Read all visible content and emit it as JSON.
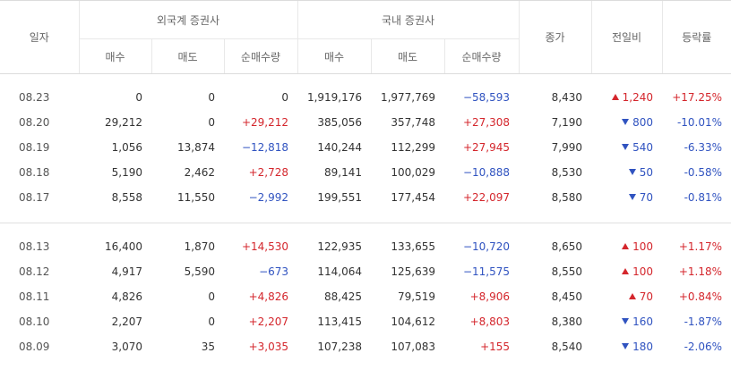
{
  "headers": {
    "date": "일자",
    "foreign_group": "외국계 증권사",
    "domestic_group": "국내 증권사",
    "buy": "매수",
    "sell": "매도",
    "net": "순매수량",
    "close": "종가",
    "change": "전일비",
    "rate": "등락률"
  },
  "group1": [
    {
      "date": "08.23",
      "f_buy": "0",
      "f_sell": "0",
      "f_net": "0",
      "d_buy": "1,919,176",
      "d_sell": "1,977,769",
      "d_net": "−58,593",
      "close": "8,430",
      "change": "1,240",
      "dir": "up",
      "rate": "+17.25%"
    },
    {
      "date": "08.20",
      "f_buy": "29,212",
      "f_sell": "0",
      "f_net": "+29,212",
      "d_buy": "385,056",
      "d_sell": "357,748",
      "d_net": "+27,308",
      "close": "7,190",
      "change": "800",
      "dir": "down",
      "rate": "-10.01%"
    },
    {
      "date": "08.19",
      "f_buy": "1,056",
      "f_sell": "13,874",
      "f_net": "−12,818",
      "d_buy": "140,244",
      "d_sell": "112,299",
      "d_net": "+27,945",
      "close": "7,990",
      "change": "540",
      "dir": "down",
      "rate": "-6.33%"
    },
    {
      "date": "08.18",
      "f_buy": "5,190",
      "f_sell": "2,462",
      "f_net": "+2,728",
      "d_buy": "89,141",
      "d_sell": "100,029",
      "d_net": "−10,888",
      "close": "8,530",
      "change": "50",
      "dir": "down",
      "rate": "-0.58%"
    },
    {
      "date": "08.17",
      "f_buy": "8,558",
      "f_sell": "11,550",
      "f_net": "−2,992",
      "d_buy": "199,551",
      "d_sell": "177,454",
      "d_net": "+22,097",
      "close": "8,580",
      "change": "70",
      "dir": "down",
      "rate": "-0.81%"
    }
  ],
  "group2": [
    {
      "date": "08.13",
      "f_buy": "16,400",
      "f_sell": "1,870",
      "f_net": "+14,530",
      "d_buy": "122,935",
      "d_sell": "133,655",
      "d_net": "−10,720",
      "close": "8,650",
      "change": "100",
      "dir": "up",
      "rate": "+1.17%"
    },
    {
      "date": "08.12",
      "f_buy": "4,917",
      "f_sell": "5,590",
      "f_net": "−673",
      "d_buy": "114,064",
      "d_sell": "125,639",
      "d_net": "−11,575",
      "close": "8,550",
      "change": "100",
      "dir": "up",
      "rate": "+1.18%"
    },
    {
      "date": "08.11",
      "f_buy": "4,826",
      "f_sell": "0",
      "f_net": "+4,826",
      "d_buy": "88,425",
      "d_sell": "79,519",
      "d_net": "+8,906",
      "close": "8,450",
      "change": "70",
      "dir": "up",
      "rate": "+0.84%"
    },
    {
      "date": "08.10",
      "f_buy": "2,207",
      "f_sell": "0",
      "f_net": "+2,207",
      "d_buy": "113,415",
      "d_sell": "104,612",
      "d_net": "+8,803",
      "close": "8,380",
      "change": "160",
      "dir": "down",
      "rate": "-1.87%"
    },
    {
      "date": "08.09",
      "f_buy": "3,070",
      "f_sell": "35",
      "f_net": "+3,035",
      "d_buy": "107,238",
      "d_sell": "107,083",
      "d_net": "+155",
      "close": "8,540",
      "change": "180",
      "dir": "down",
      "rate": "-2.06%"
    }
  ],
  "colors": {
    "up": "#d4262c",
    "down": "#3053c0"
  }
}
